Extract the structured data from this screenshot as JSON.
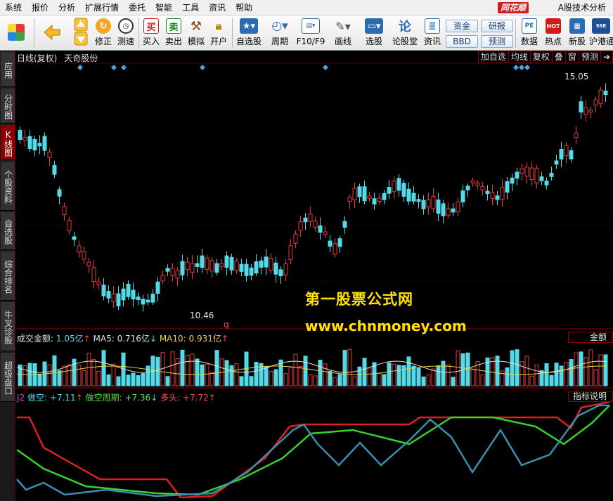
{
  "menu": [
    "系统",
    "报价",
    "分析",
    "扩展行情",
    "委托",
    "智能",
    "工具",
    "资讯",
    "帮助"
  ],
  "brand": "同花顺",
  "app_title": "A股技术分析",
  "toolbar": {
    "buttons": [
      {
        "label": "修正",
        "icon": "arrow-up-down-icon"
      },
      {
        "label": "测速",
        "icon": "clock-icon"
      },
      {
        "label": "买入",
        "glyph": "买"
      },
      {
        "label": "卖出",
        "glyph": "卖"
      },
      {
        "label": "模拟",
        "icon": "hammer-icon"
      },
      {
        "label": "开户",
        "icon": "lock-icon"
      },
      {
        "label": "自选股",
        "icon": "star-icon"
      },
      {
        "label": "周期",
        "icon": "cycle-icon"
      },
      {
        "label": "F10/F9",
        "icon": "f10-icon"
      },
      {
        "label": "画线",
        "icon": "pencil-icon"
      },
      {
        "label": "选股",
        "icon": "monitor-icon"
      },
      {
        "label": "论股堂",
        "glyph": "论"
      },
      {
        "label": "资讯",
        "icon": "news-icon"
      },
      {
        "label": "数据",
        "glyph": "PE"
      },
      {
        "label": "热点",
        "glyph": "HOT"
      },
      {
        "label": "新股",
        "icon": "new-stock-icon"
      },
      {
        "label": "沪港通",
        "glyph": "SSE"
      }
    ],
    "rect_buttons": [
      "资金",
      "BBD",
      "研报",
      "预测"
    ]
  },
  "left_tabs": [
    "应用",
    "分时图",
    "K线图",
    "个股资料",
    "自选股",
    "综合排名",
    "牛叉诊股",
    "超级盘口"
  ],
  "active_left_tab": "K线图",
  "chart": {
    "period": "日线(复权)",
    "stock_name": "天奇股份",
    "top_buttons": [
      "加自选",
      "均线",
      "复权",
      "叠",
      "窗",
      "预测"
    ],
    "high_label": "15.05",
    "low_label": "10.46",
    "marker_q": "q",
    "up_color": "#e33b3b",
    "down_color": "#54d9e6"
  },
  "volume": {
    "title": "成交金额:",
    "value": "1.05亿",
    "value_arrow": "↑",
    "ma5_label": "MA5:",
    "ma5_value": "0.716亿",
    "ma5_arrow": "↓",
    "ma10_label": "MA10:",
    "ma10_value": "0.931亿",
    "ma10_arrow": "↑",
    "button": "金额"
  },
  "indicator": {
    "name": "J2",
    "l1_label": "做空:",
    "l1_value": "+7.11",
    "l1_arrow": "↑",
    "l2_label": "做空周期:",
    "l2_value": "+7.36",
    "l2_arrow": "↓",
    "l3_label": "多头:",
    "l3_value": "+7.72",
    "l3_arrow": "↑",
    "button": "指标说明"
  },
  "watermark": {
    "line1": "第一股票公式网",
    "line2": "www.chnmoney.com"
  }
}
